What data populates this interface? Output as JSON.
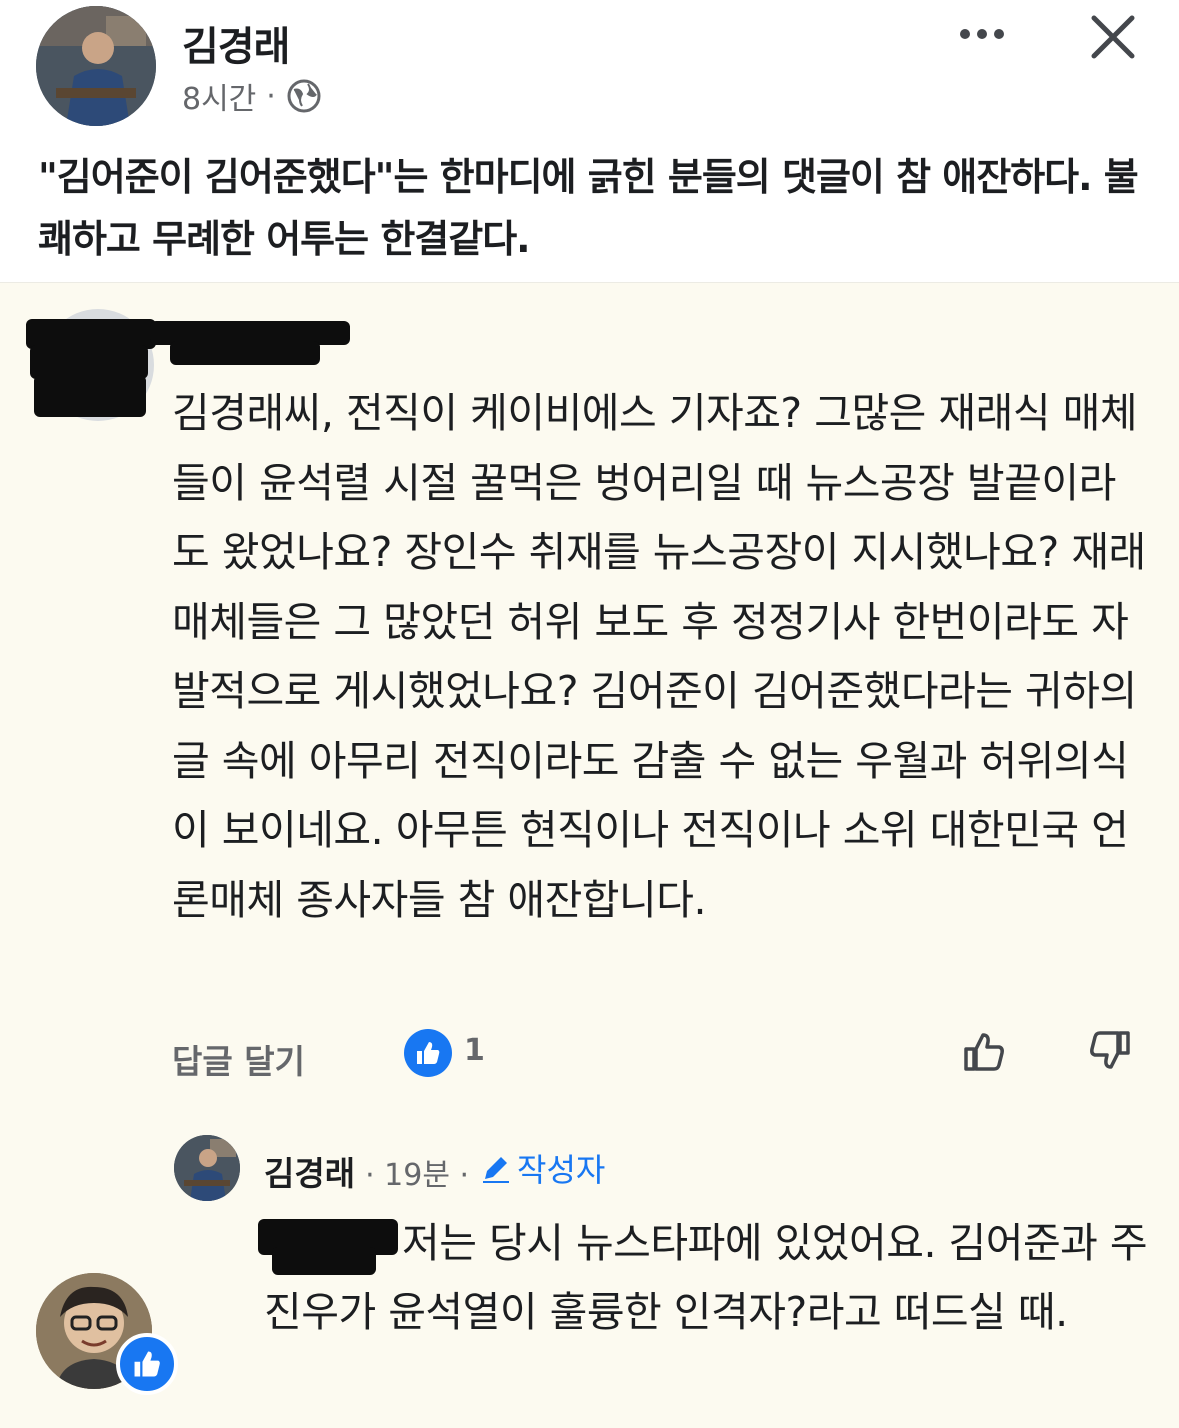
{
  "post": {
    "author_name": "김경래",
    "time": "8시간",
    "separator": "·",
    "audience_icon": "globe-icon",
    "text": "\"김어준이 김어준했다\"는 한마디에 긁힌 분들의 댓글이 참 애잔하다. 불쾌하고 무례한 어투는 한결같다."
  },
  "comment": {
    "author_name": "",
    "body": "김경래씨, 전직이 케이비에스 기자죠? 그많은 재래식 매체들이 윤석렬 시절 꿀먹은 벙어리일 때 뉴스공장 발끝이라도 왔었나요?  장인수 취재를 뉴스공장이 지시했나요? 재래 매체들은 그 많았던 허위 보도 후 정정기사 한번이라도 자발적으로 게시했었나요? 김어준이 김어준했다라는 귀하의 글 속에 아무리 전직이라도 감출 수 없는 우월과 허위의식이 보이네요. 아무튼 현직이나 전직이나 소위 대한민국 언론매체 종사자들 참 애잔합니다.",
    "reply_label": "답글 달기",
    "like_count": "1",
    "accent_color": "#1877f2"
  },
  "reply": {
    "author_name": "김경래",
    "time": "· 19분 ·",
    "badge": "작성자",
    "body": "저는 당시 뉴스타파에 있었어요. 김어준과 주진우가 윤석열이 훌륭한 인격자?라고 떠드실 때."
  }
}
